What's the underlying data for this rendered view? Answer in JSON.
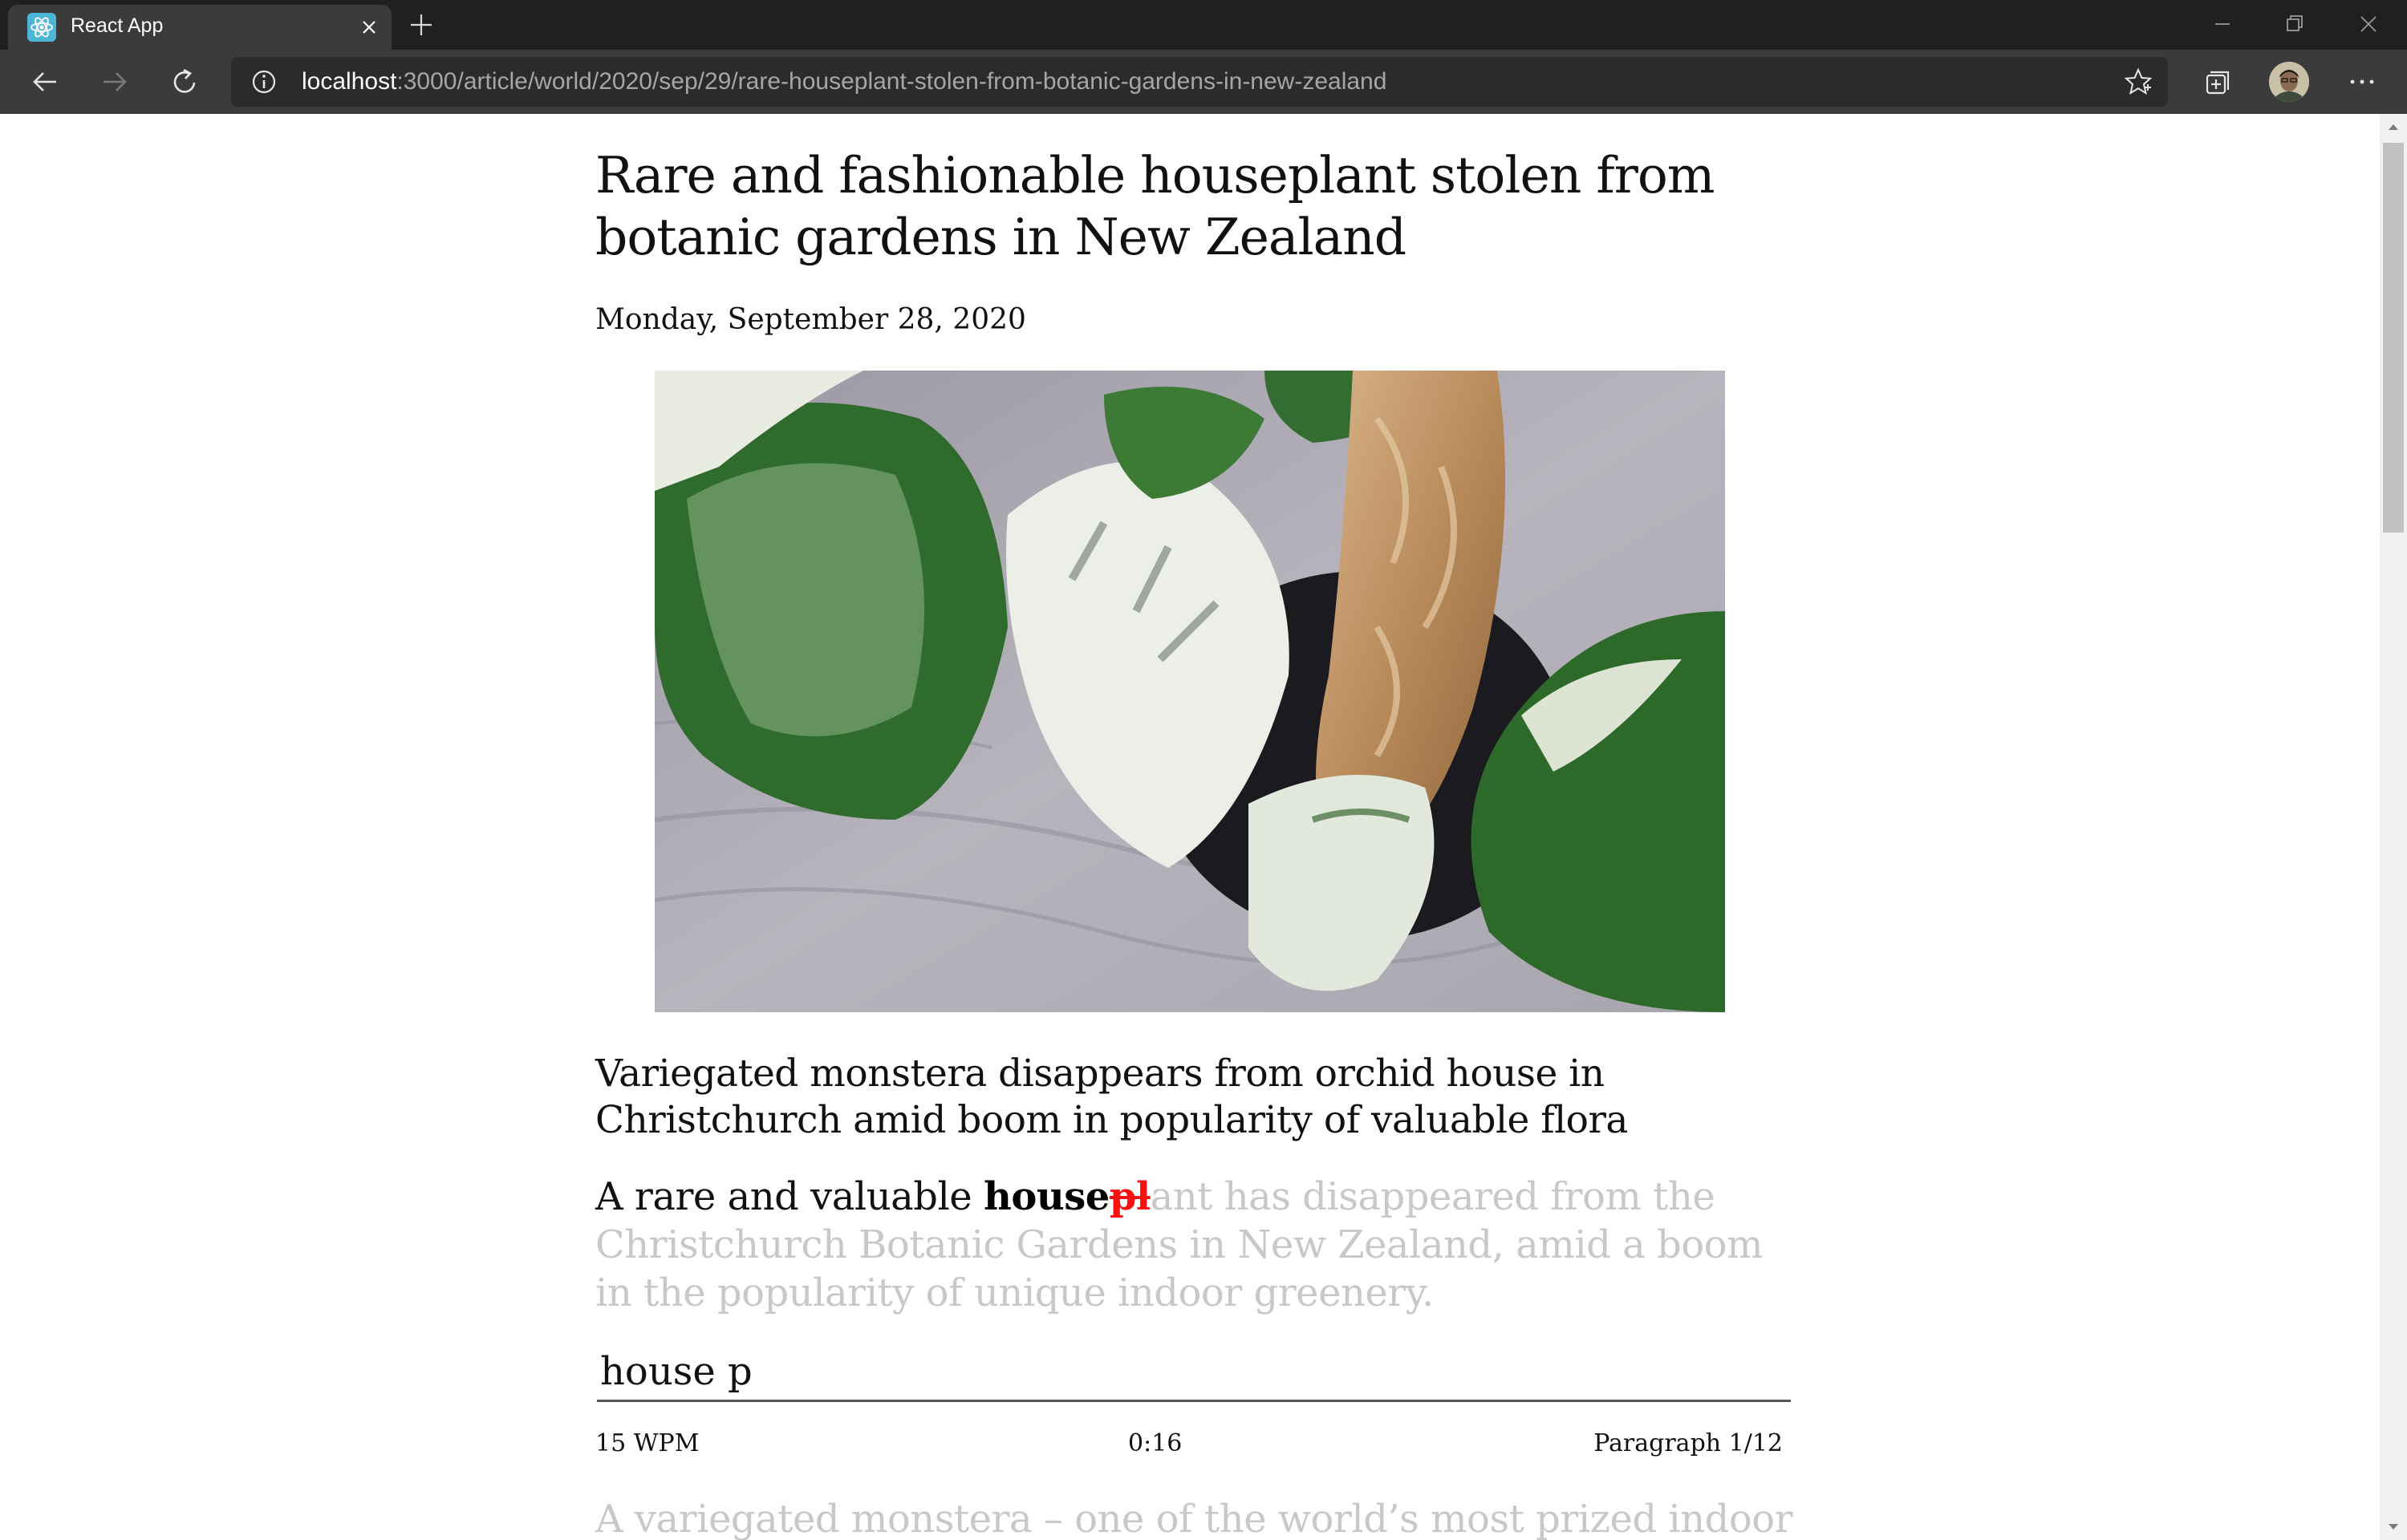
{
  "browser": {
    "tab_title": "React App",
    "url_host": "localhost",
    "url_rest": ":3000/article/world/2020/sep/29/rare-houseplant-stolen-from-botanic-gardens-in-new-zealand"
  },
  "article": {
    "headline": "Rare and fashionable houseplant stolen from botanic gardens in New Zealand",
    "date": "Monday, September 28, 2020",
    "subheadline": "Variegated monstera disappears from orchid house in Christchurch amid boom in popularity of valuable flora",
    "paragraph": {
      "typed": "A rare and valuable ",
      "current_correct": "house",
      "current_error": "pl",
      "remaining": "ant has disappeared from the Christchurch Botanic Gardens in New Zealand, amid a boom in the popularity of unique indoor greenery."
    },
    "next_paragraph": "A variegated monstera – one of the world’s most prized indoor"
  },
  "typing": {
    "input_value": "house p",
    "wpm": "15 WPM",
    "timer": "0:16",
    "progress": "Paragraph 1/12"
  },
  "colors": {
    "error": "#ff1010",
    "remaining": "#c8c8c8",
    "chrome_dark": "#202020",
    "chrome_toolbar": "#3b3b3b"
  }
}
